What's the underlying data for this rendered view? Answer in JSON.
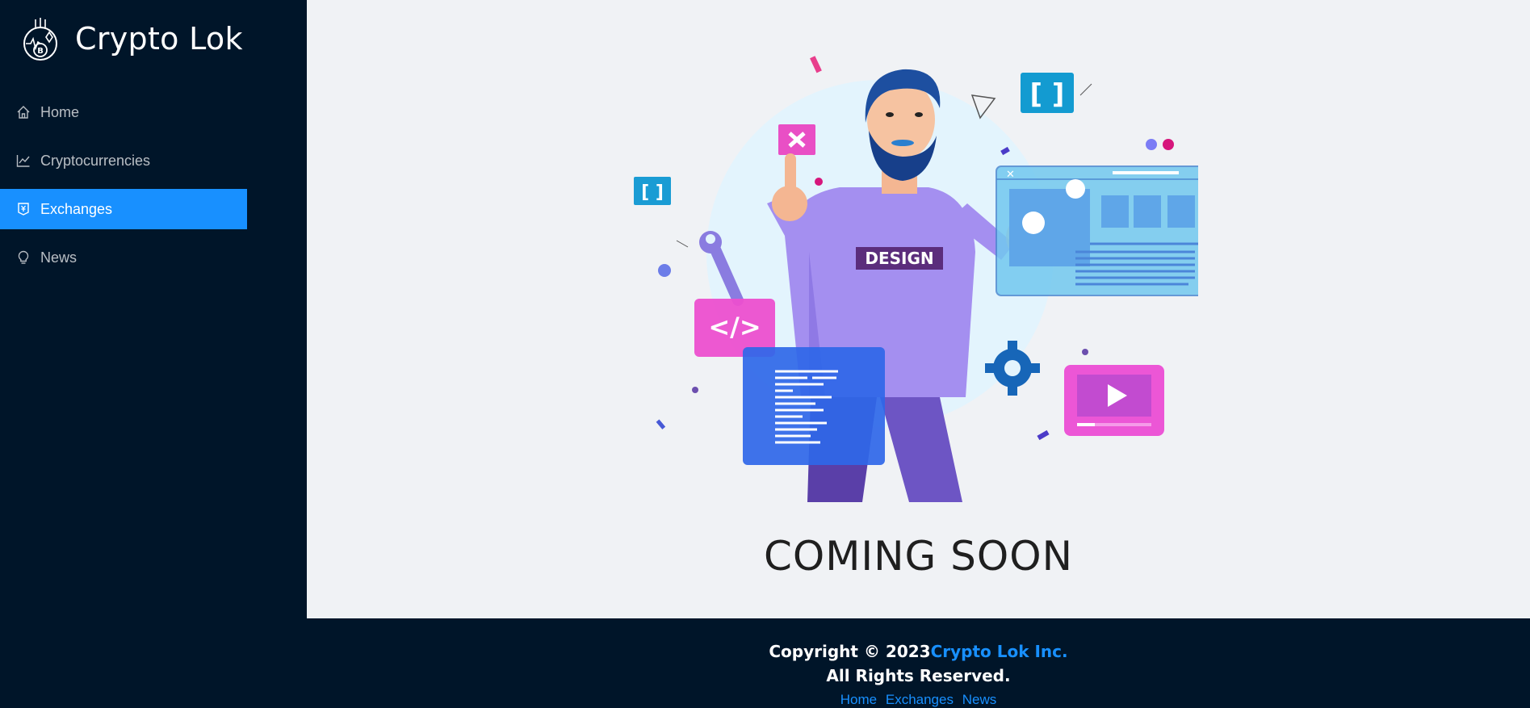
{
  "brand": {
    "name": "Crypto Lok"
  },
  "menu": [
    {
      "label": "Home",
      "icon": "home-icon",
      "active": false
    },
    {
      "label": "Cryptocurrencies",
      "icon": "line-chart-icon",
      "active": false
    },
    {
      "label": "Exchanges",
      "icon": "money-collect-icon",
      "active": true
    },
    {
      "label": "News",
      "icon": "bulb-icon",
      "active": false
    }
  ],
  "main": {
    "title": "COMING SOON",
    "illustration": {
      "badge_text": "DESIGN"
    }
  },
  "footer": {
    "copyright_prefix": "Copyright © 2023",
    "company": "Crypto Lok Inc.",
    "rights": "All Rights Reserved.",
    "links": [
      "Home",
      "Exchanges",
      "News"
    ]
  },
  "colors": {
    "sidebar_bg": "#001529",
    "accent": "#1890ff",
    "main_bg": "#f0f2f5"
  }
}
